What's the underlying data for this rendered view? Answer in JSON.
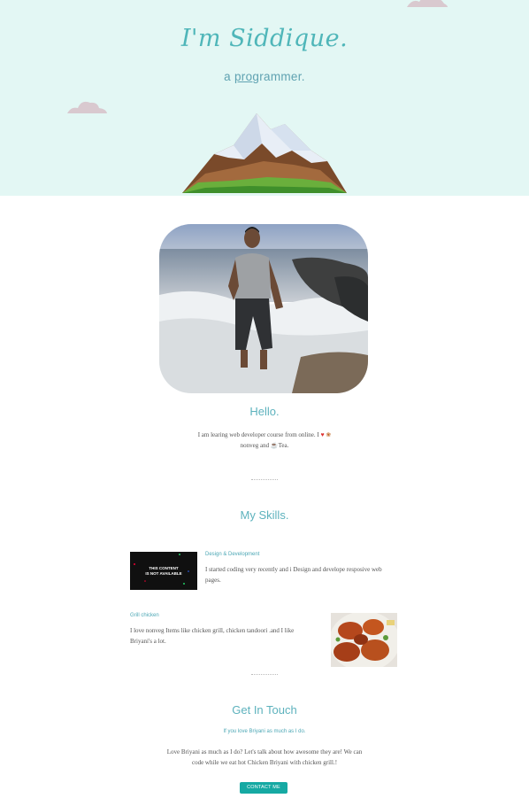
{
  "hero": {
    "title": "I'm Siddique.",
    "subtitle_a": "a ",
    "subtitle_b": "pro",
    "subtitle_c": "grammer."
  },
  "about": {
    "heading": "Hello.",
    "text_line1": "I am learing web developer course from online. I ",
    "text_line1_end": "",
    "text_line2": "nonveg and ",
    "text_line2_end": "Tea.",
    "icons": [
      "heart-icon",
      "drumstick-icon",
      "tea-cup-icon"
    ]
  },
  "skills": {
    "heading": "My Skills.",
    "items": [
      {
        "title": "Design & Development",
        "image_text_1": "THIS CONTENT",
        "image_text_2": "IS NOT AVAILABLE",
        "text_line1": "I started coding very recently and i Design and develope resposive web",
        "text_line2": "pages."
      },
      {
        "title": "Grill chicken",
        "text_line1": "I love nonveg Items like chicken grill, chicken tandoori .and I like",
        "text_line2": "Briyani's a lot."
      }
    ]
  },
  "contact": {
    "heading": "Get In Touch",
    "subheading": "If you love Briyani as much as I do.",
    "text_line1": "Love Briyani as much as I do? Let's talk about how awesome they are! We can",
    "text_line2": "code while we eat hot Chicken Briyani with chicken grill.!",
    "button_label": "CONTACT ME"
  },
  "colors": {
    "hero_bg": "#e3f7f4",
    "accent": "#4fb6b9",
    "button": "#16a9a3"
  }
}
